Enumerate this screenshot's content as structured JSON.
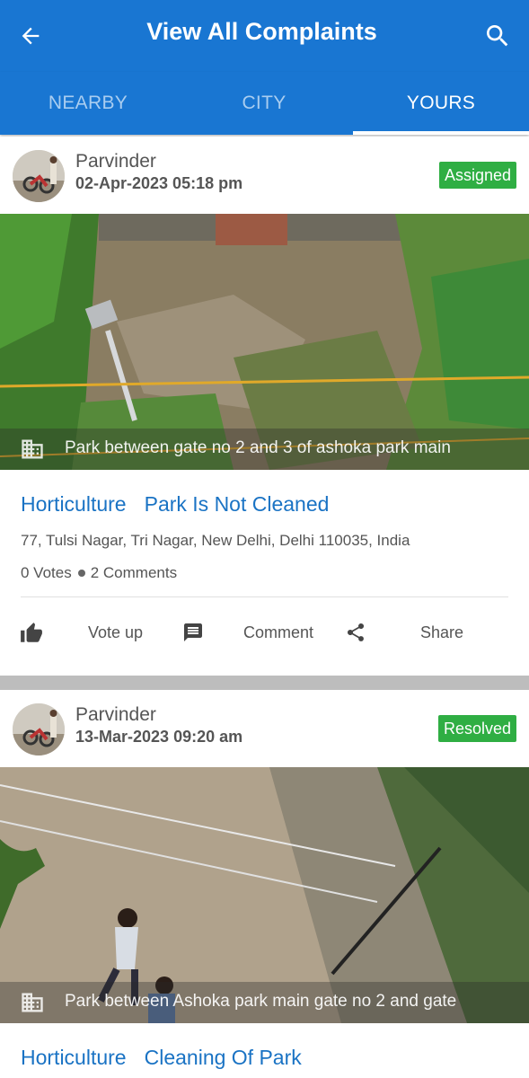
{
  "appbar": {
    "title": "View All Complaints",
    "back_icon": "arrow-left-icon",
    "search_icon": "search-icon",
    "color": "#1976d2"
  },
  "tabs": [
    {
      "label": "NEARBY",
      "active": false
    },
    {
      "label": "CITY",
      "active": false
    },
    {
      "label": "YOURS",
      "active": true
    }
  ],
  "complaints": [
    {
      "user": "Parvinder",
      "date": "02-Apr-2023 05:18 pm",
      "status": "Assigned",
      "status_color": "#2fae43",
      "location": "Park between gate no 2 and 3 of ashoka park main",
      "category": "Horticulture",
      "subcategory": "Park Is Not Cleaned",
      "address": "77, Tulsi Nagar, Tri Nagar, New Delhi, Delhi 110035, India",
      "votes": "0 Votes",
      "comments": "2 Comments",
      "actions": {
        "vote": "Vote up",
        "comment": "Comment",
        "share": "Share"
      }
    },
    {
      "user": "Parvinder",
      "date": "13-Mar-2023 09:20 am",
      "status": "Resolved",
      "status_color": "#2fae43",
      "location": "Park between Ashoka park main gate no 2 and gate",
      "category": "Horticulture",
      "subcategory": "Cleaning Of Park"
    }
  ]
}
